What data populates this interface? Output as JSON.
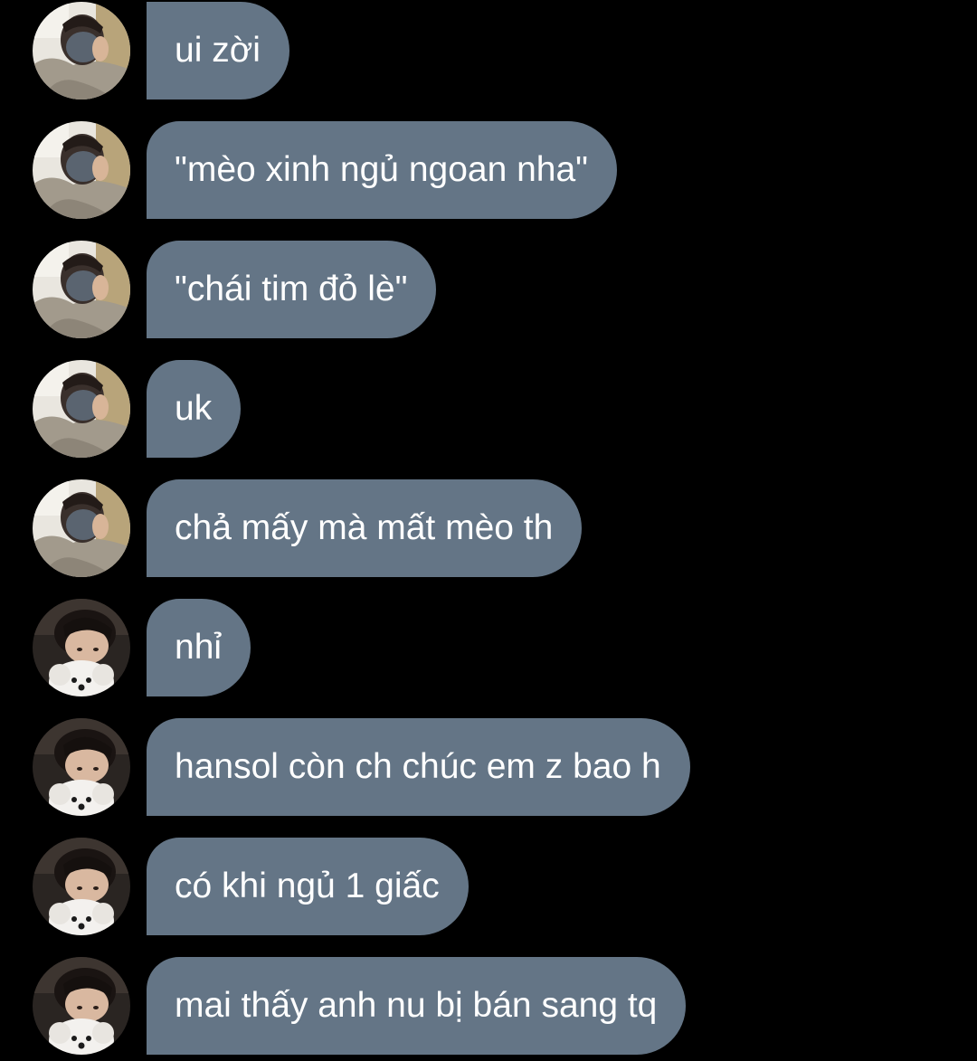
{
  "theme": {
    "background": "#000000",
    "bubble_color": "#647586",
    "text_color": "#ffffff"
  },
  "messages": [
    {
      "sender": "user-a",
      "avatar_icon": "user-a-avatar-icon",
      "text": "ui zời"
    },
    {
      "sender": "user-a",
      "avatar_icon": "user-a-avatar-icon",
      "text": "\"mèo xinh ngủ ngoan nha\""
    },
    {
      "sender": "user-a",
      "avatar_icon": "user-a-avatar-icon",
      "text": "\"chái tim đỏ lè\""
    },
    {
      "sender": "user-a",
      "avatar_icon": "user-a-avatar-icon",
      "text": "uk"
    },
    {
      "sender": "user-a",
      "avatar_icon": "user-a-avatar-icon",
      "text": "chả mấy mà mất mèo th"
    },
    {
      "sender": "user-b",
      "avatar_icon": "user-b-avatar-icon",
      "text": "nhỉ"
    },
    {
      "sender": "user-b",
      "avatar_icon": "user-b-avatar-icon",
      "text": "hansol còn ch chúc em z bao h"
    },
    {
      "sender": "user-b",
      "avatar_icon": "user-b-avatar-icon",
      "text": "có khi ngủ 1 giấc"
    },
    {
      "sender": "user-b",
      "avatar_icon": "user-b-avatar-icon",
      "text": "mai thấy anh nu bị bán sang tq"
    }
  ]
}
